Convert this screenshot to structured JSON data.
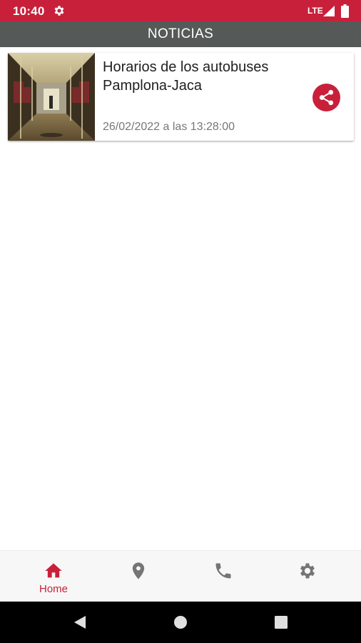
{
  "status_bar": {
    "time": "10:40",
    "network": "LTE",
    "background_color": "#c8203a",
    "icons": [
      "gear-icon",
      "signal-icon",
      "battery-icon"
    ]
  },
  "app_bar": {
    "title": "NOTICIAS",
    "background_color": "#555a58"
  },
  "news": [
    {
      "title": "Horarios de los autobuses Pamplona-Jaca",
      "date": "26/02/2022 a las 13:28:00",
      "image": "bus-interior-photo",
      "action_icon": "share-icon"
    }
  ],
  "bottom_nav": {
    "items": [
      {
        "label": "Home",
        "icon": "home-icon",
        "active": true
      },
      {
        "label": "",
        "icon": "location-pin-icon",
        "active": false
      },
      {
        "label": "",
        "icon": "phone-icon",
        "active": false
      },
      {
        "label": "",
        "icon": "settings-gear-icon",
        "active": false
      }
    ],
    "active_color": "#c8203a",
    "inactive_color": "#757575"
  },
  "system_nav": {
    "buttons": [
      "back-icon",
      "home-circle-icon",
      "recents-square-icon"
    ]
  }
}
